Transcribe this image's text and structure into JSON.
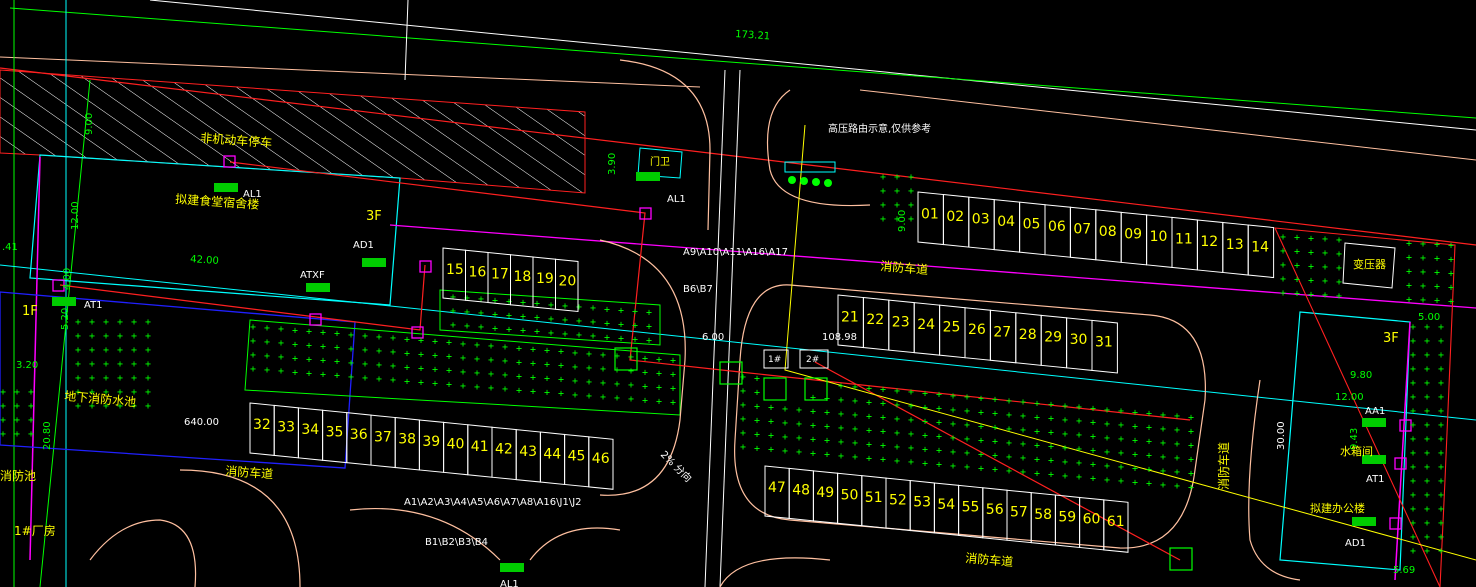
{
  "colors": {
    "background": "#000000",
    "red": "#ff2020",
    "green": "#00ff00",
    "cyan": "#00ffff",
    "yellow": "#ffff00",
    "white": "#ffffff",
    "magenta": "#ff00ff",
    "blue": "#2020ff",
    "peach": "#ffc0a0"
  },
  "dimensions": {
    "total_width": "173.21",
    "left_9": "9.00",
    "left_12": "12.00",
    "gate_390": "3.90",
    "dim_42": "42.00",
    "dim_400": "4.00",
    "dim_520": "5.20",
    "dim_320": "3.20",
    "dim_2080": "20.80",
    "area_640": "640.00",
    "road_600": "6.00",
    "road_10898": "108.98",
    "dim_900b": "9.00",
    "right_500": "5.00",
    "right_980": "9.80",
    "right_1200": "12.00",
    "right_943": "9.43",
    "right_3000": "30.00",
    "right_569": "5.69",
    "left_edge": ".41"
  },
  "labels": {
    "bicycle_shed": "非机动车停车",
    "canteen_dorm": "拟建食堂宿舍楼",
    "al1_a": "AL1",
    "al1_b": "AL1",
    "al1_c": "AL1",
    "floor_3f_left": "3F",
    "floor_3f_right": "3F",
    "floor_1f": "1F",
    "ad1_left": "AD1",
    "ad1_right": "AD1",
    "atxf": "ATXF",
    "at1_left": "AT1",
    "at1_right": "AT1",
    "aa1": "AA1",
    "gatehouse": "门卫",
    "hv_route_note": "高压路由示意,仅供参考",
    "circuits_top": "A9\\A10\\A11\\A16\\A17",
    "circuits_b6b7": "B6\\B7",
    "circuits_bottom": "A1\\A2\\A3\\A4\\A5\\A6\\A7\\A8\\A16\\J1\\J2",
    "circuits_b": "B1\\B2\\B3\\B4",
    "fire_road_top": "消防车道",
    "fire_road_left": "消防车道",
    "fire_road_bottom": "消防车道",
    "fire_road_right": "消防车道",
    "underground_pool": "地下消防水池",
    "fire_pool_left": "消防池",
    "factory_1": "1#厂房",
    "transformer": "变压器",
    "water_room": "水箱间",
    "office_bldg": "拟建办公楼",
    "manhole_1": "1#",
    "manhole_2": "2#",
    "direction_note": "2%  分向"
  },
  "parking": {
    "row_top_right": [
      "01",
      "02",
      "03",
      "04",
      "05",
      "06",
      "07",
      "08",
      "09",
      "10",
      "11",
      "12",
      "13",
      "14"
    ],
    "row_mid_left": [
      "15",
      "16",
      "17",
      "18",
      "19",
      "20"
    ],
    "row_mid_right": [
      "21",
      "22",
      "23",
      "24",
      "25",
      "26",
      "27",
      "28",
      "29",
      "30",
      "31"
    ],
    "row_bottom_left": [
      "32",
      "33",
      "34",
      "35",
      "36",
      "37",
      "38",
      "39",
      "40",
      "41",
      "42",
      "43",
      "44",
      "45",
      "46"
    ],
    "row_bottom_right": [
      "47",
      "48",
      "49",
      "50",
      "51",
      "52",
      "53",
      "54",
      "55",
      "56",
      "57",
      "58",
      "59",
      "60",
      "61"
    ]
  }
}
